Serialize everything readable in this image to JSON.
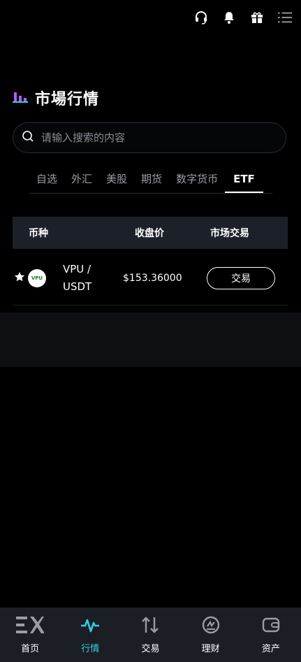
{
  "header": {
    "icons": [
      "headset-icon",
      "bell-icon",
      "gift-icon",
      "menu-icon"
    ]
  },
  "page": {
    "title": "市場行情",
    "title_icon": "bar-chart-icon"
  },
  "search": {
    "placeholder": "请输入搜索的内容"
  },
  "tabs": [
    {
      "label": "自选"
    },
    {
      "label": "外汇"
    },
    {
      "label": "美股"
    },
    {
      "label": "期货"
    },
    {
      "label": "数字货币"
    },
    {
      "label": "ETF",
      "active": true
    }
  ],
  "table": {
    "headers": {
      "currency": "币种",
      "close_price": "收盘价",
      "market_trade": "市场交易"
    },
    "rows": [
      {
        "logo_text": "VPU",
        "pair_line1": "VPU /",
        "pair_line2": "USDT",
        "price": "$153.36000",
        "action": "交易"
      }
    ]
  },
  "bottom_nav": [
    {
      "label": "首页",
      "icon": "home-logo-icon"
    },
    {
      "label": "行情",
      "icon": "pulse-icon",
      "active": true
    },
    {
      "label": "交易",
      "icon": "swap-arrows-icon"
    },
    {
      "label": "理财",
      "icon": "finance-icon"
    },
    {
      "label": "资产",
      "icon": "wallet-icon"
    }
  ],
  "colors": {
    "accent": "#2fd0e6",
    "title_icon": "#b35cf0",
    "nav_bg": "#1c1e26",
    "table_header_bg": "#1c2029"
  }
}
